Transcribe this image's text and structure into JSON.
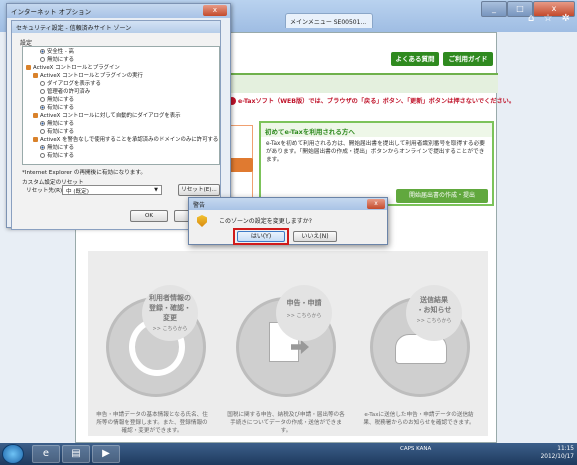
{
  "browser": {
    "tab_title": "メインメニュー SE00501...",
    "close_glyph": "x",
    "minimize_glyph": "_",
    "maximize_glyph": "□",
    "toolbar_glyphs": "⌂ ☆ ✲"
  },
  "page": {
    "header_buttons": [
      "よくある質問",
      "ご利用ガイド"
    ],
    "warning": "e-Taxソフト（WEB版）では、ブラウザの「戻る」ボタン、「更新」ボタンは押さないでください。",
    "first_time": {
      "title": "初めてe-Taxを利用される方へ",
      "text": "e-Taxを初めて利用される方は、開始届出書を提出して利用者識別番号を取得する必要があります。「開始届出書の作成・提出」ボタンからオンラインで提出することができます。",
      "button": "開始届出書の作成・提出"
    },
    "features": [
      {
        "title": "利用者情報の\n登録・確認・\n変更",
        "sub": ">> こちらから",
        "text": "申告・申請データの基本情報となる氏名、住所等の情報を登録します。また、登録情報の確認・変更ができます。"
      },
      {
        "title": "申告・申請",
        "sub": ">> こちらから",
        "text": "国税に関する申告、納税及び申請・届出等の各手続きについてデータの作成・送信ができます。"
      },
      {
        "title": "送信結果\n・お知らせ",
        "sub": ">> こちらから",
        "text": "e-Taxに送信した申告・申請データの送信結果、税務署からのお知らせを確認できます。"
      }
    ]
  },
  "internet_options": {
    "title": "インターネット オプション",
    "close_glyph": "x",
    "zone_dialog": {
      "title": "セキュリティ設定 - 信頼済みサイト ゾーン",
      "group_label": "設定",
      "items": [
        {
          "type": "radio",
          "checked": true,
          "label": "安全性 - 高",
          "indent": 2
        },
        {
          "type": "radio",
          "checked": false,
          "label": "無効にする",
          "indent": 2
        },
        {
          "type": "gear",
          "label": "ActiveX コントロールとプラグイン",
          "indent": 0
        },
        {
          "type": "gear",
          "label": "ActiveX コントロールとプラグインの実行",
          "indent": 1
        },
        {
          "type": "radio",
          "checked": false,
          "label": "ダイアログを表示する",
          "indent": 2
        },
        {
          "type": "radio",
          "checked": false,
          "label": "管理者の許可済み",
          "indent": 2
        },
        {
          "type": "radio",
          "checked": false,
          "label": "無効にする",
          "indent": 2
        },
        {
          "type": "radio",
          "checked": true,
          "label": "有効にする",
          "indent": 2
        },
        {
          "type": "gear",
          "label": "ActiveX コントロールに対して自動的にダイアログを表示",
          "indent": 1
        },
        {
          "type": "radio",
          "checked": true,
          "label": "無効にする",
          "indent": 2
        },
        {
          "type": "radio",
          "checked": false,
          "label": "有効にする",
          "indent": 2
        },
        {
          "type": "gear",
          "label": "ActiveX を警告なしで使用することを承認済みのドメインのみに許可する",
          "indent": 1
        },
        {
          "type": "radio",
          "checked": true,
          "label": "無効にする",
          "indent": 2
        },
        {
          "type": "radio",
          "checked": false,
          "label": "有効にする",
          "indent": 2
        }
      ],
      "restart_note": "*Internet Explorer の再開後に有効になります。",
      "custom_reset_label": "カスタム設定のリセット",
      "reset_to_label": "リセット先(R):",
      "reset_select_value": "中 (既定)",
      "reset_button": "リセット(E)...",
      "ok_button": "OK"
    }
  },
  "warning_dialog": {
    "title": "警告",
    "close_glyph": "x",
    "message": "このゾーンの設定を変更しますか?",
    "yes_button": "はい(Y)",
    "no_button": "いいえ(N)"
  },
  "taskbar": {
    "tray_text": "CAPS KANA",
    "time": "11:15",
    "date": "2012/10/17"
  }
}
